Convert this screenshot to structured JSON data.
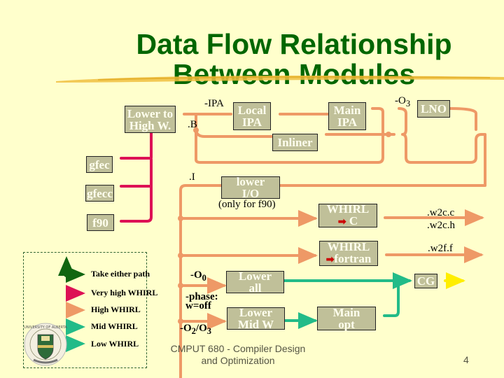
{
  "title": {
    "line1": "Data Flow Relationship",
    "line2": "Between Modules"
  },
  "colors": {
    "title": "#006600",
    "background": "#ffffcc",
    "box_fill": "#c0c099",
    "very_high_whirl": "#dd1155",
    "high_whirl": "#ee9966",
    "mid_whirl": "#22bb88",
    "low_whirl": "#22bb88",
    "take_either_path": "#116611",
    "cg_output": "#ffee00"
  },
  "boxes": {
    "lower_to_high_w": {
      "line1": "Lower to",
      "line2": "High W."
    },
    "local_ipa": {
      "line1": "Local",
      "line2": "IPA"
    },
    "main_ipa": {
      "line1": "Main",
      "line2": "IPA"
    },
    "lno": {
      "line1": "LNO"
    },
    "inliner": {
      "line1": "Inliner"
    },
    "gfec": {
      "line1": "gfec"
    },
    "gfecc": {
      "line1": "gfecc"
    },
    "f90": {
      "line1": "f90"
    },
    "lower_io": {
      "line1": "lower",
      "line2": "I/O"
    },
    "whirl_c": {
      "line1": "WHIRL",
      "line2": "C"
    },
    "whirl_fortran": {
      "line1": "WHIRL",
      "line2": "fortran"
    },
    "lower_all": {
      "line1": "Lower",
      "line2": "all"
    },
    "lower_mid_w": {
      "line1": "Lower",
      "line2": "Mid W"
    },
    "main_opt": {
      "line1": "Main",
      "line2": "opt"
    },
    "cg": {
      "line1": "CG"
    }
  },
  "labels": {
    "ipa_flag": "-IPA",
    "b_ext": ".B",
    "o3_flag": "-O",
    "o3_sub": "3",
    "i_ext": ".I",
    "only_for_f90": "(only for f90)",
    "w2c_c": ".w2c.c",
    "w2c_h": ".w2c.h",
    "w2f_f": ".w2f.f",
    "o0_flag": "-O",
    "o0_sub": "0",
    "phase_flag_1": "-phase:",
    "phase_flag_2": "w=off",
    "o2o3_a": "-O",
    "o2o3_sub2": "2",
    "o2o3_mid": "/O",
    "o2o3_sub3": "3",
    "red_arrow": "➡"
  },
  "legend": {
    "items": [
      {
        "label": "Take either path",
        "icon": "take-either-path-icon"
      },
      {
        "label": "Very high WHIRL",
        "icon": "very-high-whirl-arrow"
      },
      {
        "label": "High WHIRL",
        "icon": "high-whirl-arrow"
      },
      {
        "label": "Mid WHIRL",
        "icon": "mid-whirl-arrow"
      },
      {
        "label": "Low WHIRL",
        "icon": "low-whirl-arrow"
      }
    ]
  },
  "footer": {
    "line1": "CMPUT 680 - Compiler Design",
    "line2": "and Optimization",
    "page_number": "4"
  },
  "logo": {
    "text": "UNIVERSITY OF ALBERTA",
    "icon": "university-crest-icon"
  }
}
